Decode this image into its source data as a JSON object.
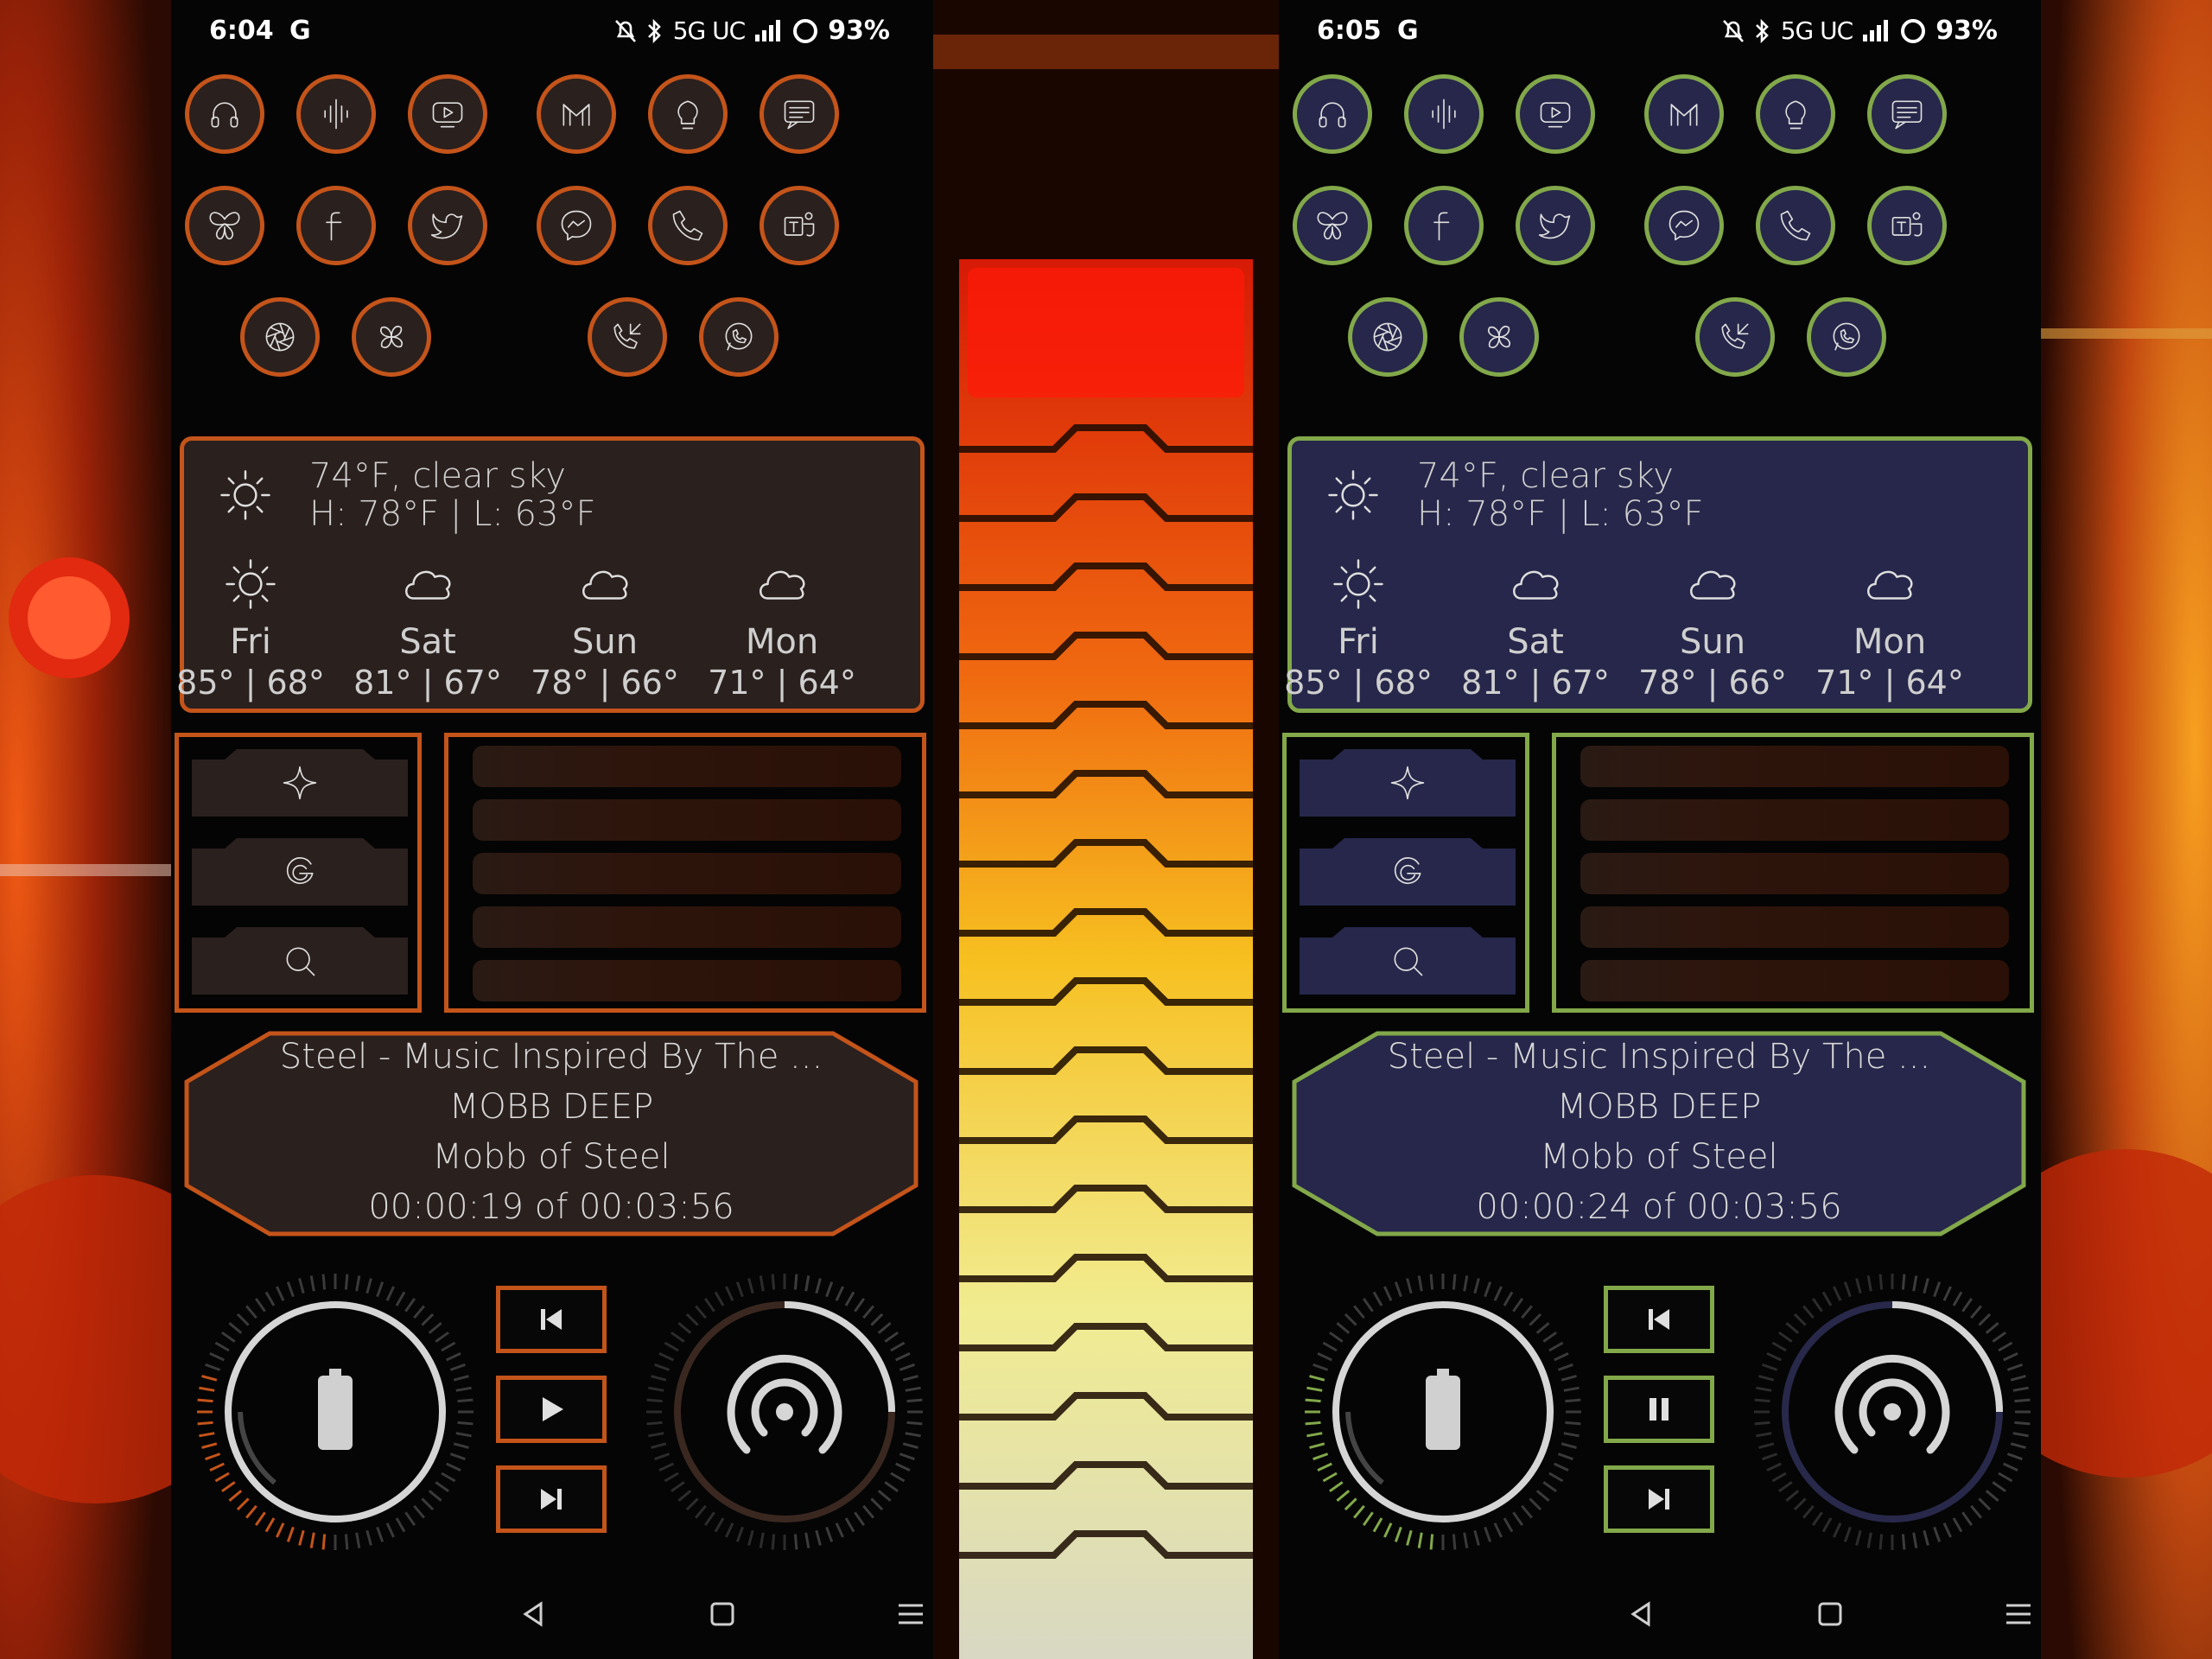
{
  "phones": [
    {
      "id": "left",
      "accent": "#c4541a",
      "fill": "#2a201e",
      "status": {
        "time": "6:04",
        "carrier_icon": "G",
        "network": "5G UC",
        "battery": "93%"
      },
      "weather": {
        "current": "74°F, clear sky",
        "high_low": "H: 78°F | L: 63°F",
        "days": [
          {
            "name": "Fri",
            "temps": "85° | 68°",
            "icon": "sun-icon"
          },
          {
            "name": "Sat",
            "temps": "81° | 67°",
            "icon": "cloud-icon"
          },
          {
            "name": "Sun",
            "temps": "78° | 66°",
            "icon": "cloud-icon"
          },
          {
            "name": "Mon",
            "temps": "71° | 64°",
            "icon": "cloud-icon"
          }
        ]
      },
      "music": {
        "title": "Steel - Music Inspired By The ...",
        "artist": "MOBB DEEP",
        "album": "Mobb of Steel",
        "progress": "00:00:19 of 00:03:56"
      },
      "play_state": "play"
    },
    {
      "id": "right",
      "accent": "#82a84a",
      "fill": "#26274a",
      "status": {
        "time": "6:05",
        "carrier_icon": "G",
        "network": "5G UC",
        "battery": "93%"
      },
      "weather": {
        "current": "74°F, clear sky",
        "high_low": "H: 78°F | L: 63°F",
        "days": [
          {
            "name": "Fri",
            "temps": "85° | 68°",
            "icon": "sun-icon"
          },
          {
            "name": "Sat",
            "temps": "81° | 67°",
            "icon": "cloud-icon"
          },
          {
            "name": "Sun",
            "temps": "78° | 66°",
            "icon": "cloud-icon"
          },
          {
            "name": "Mon",
            "temps": "71° | 64°",
            "icon": "cloud-icon"
          }
        ]
      },
      "music": {
        "title": "Steel - Music Inspired By The ...",
        "artist": "MOBB DEEP",
        "album": "Mobb of Steel",
        "progress": "00:00:24 of 00:03:56"
      },
      "play_state": "pause"
    }
  ],
  "app_icons": [
    "headphones-icon",
    "podcast-icon",
    "youtube-icon",
    "gmail-icon",
    "lightbulb-icon",
    "messages-icon",
    "butterfly-icon",
    "facebook-icon",
    "twitter-icon",
    "messenger-icon",
    "phone-icon",
    "teams-icon",
    "camera-aperture-icon",
    "pinwheel-icon",
    "phone-calls-icon",
    "whatsapp-icon"
  ],
  "search_icons": [
    "sparkle-icon",
    "google-icon",
    "search-icon"
  ],
  "nav_icons": [
    "back-icon",
    "home-icon",
    "recents-icon"
  ]
}
